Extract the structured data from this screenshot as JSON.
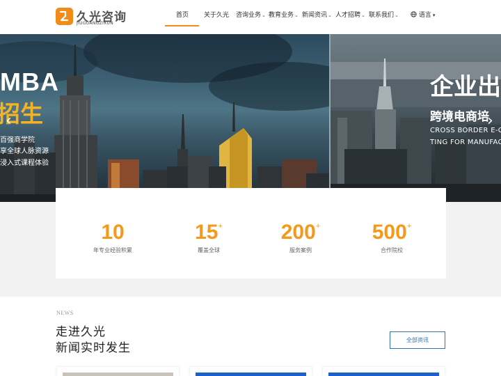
{
  "brand": {
    "name_cn": "久光咨询",
    "name_en": "JIUGUANGZIXUN",
    "accent": "#f08c1a"
  },
  "nav": {
    "items": [
      {
        "label": "首页",
        "has_dropdown": false
      },
      {
        "label": "关于久光",
        "has_dropdown": false
      },
      {
        "label": "咨询业务",
        "has_dropdown": true
      },
      {
        "label": "教育业务",
        "has_dropdown": true
      },
      {
        "label": "新闻资讯",
        "has_dropdown": true
      },
      {
        "label": "人才招聘",
        "has_dropdown": true
      },
      {
        "label": "联系我们",
        "has_dropdown": true
      }
    ],
    "active": "首页",
    "language_label": "语言"
  },
  "banner": {
    "left": {
      "title": "MBA",
      "subtitle": "招生",
      "lines": [
        "百强商学院",
        "享全球人脉资源",
        "浸入式课程体验"
      ]
    },
    "right": {
      "title": "企业出",
      "subtitle": "跨境电商培",
      "en_lines": [
        "CROSS BORDER E-CO",
        "TING FOR MANUFACT"
      ]
    },
    "prev_arrow": "‹",
    "next_arrow": "›"
  },
  "stats": [
    {
      "value": "10",
      "plus": "",
      "label": "年专业经验积累"
    },
    {
      "value": "15",
      "plus": "+",
      "label": "覆盖全球"
    },
    {
      "value": "200",
      "plus": "+",
      "label": "服务案例"
    },
    {
      "value": "500",
      "plus": "+",
      "label": "合作院校"
    }
  ],
  "news": {
    "tag": "NEWS",
    "title_line1": "走进久光",
    "title_line2": "新闻实时发生",
    "all_button": "全部资讯"
  },
  "colors": {
    "stat_number": "#f39a1c",
    "button_blue": "#2f6fb8",
    "banner_yellow": "#f5b324"
  }
}
